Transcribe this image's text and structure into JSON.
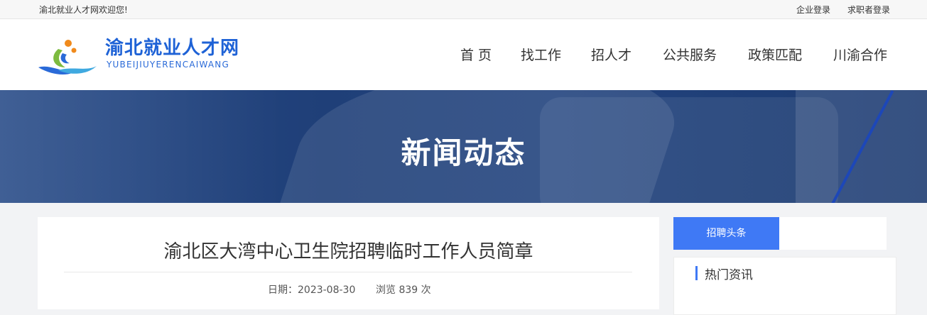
{
  "topbar": {
    "welcome": "渝北就业人才网欢迎您!",
    "company_login": "企业登录",
    "seeker_login": "求职者登录"
  },
  "brand": {
    "name": "渝北就业人才网",
    "pinyin": "YUBEIJIUYERENCAIWANG",
    "colors": {
      "primary": "#1e62d6",
      "accent": "#3f79f5",
      "orange": "#f08a1c",
      "green": "#7dbb3f"
    }
  },
  "nav": {
    "items": [
      {
        "label": "首 页"
      },
      {
        "label": "找工作"
      },
      {
        "label": "招人才"
      },
      {
        "label": "公共服务"
      },
      {
        "label": "政策匹配"
      },
      {
        "label": "川渝合作"
      }
    ]
  },
  "banner": {
    "title": "新闻动态"
  },
  "article": {
    "title": "渝北区大湾中心卫生院招聘临时工作人员简章",
    "date_label": "日期：2023-08-30",
    "views_label": "浏览 839 次"
  },
  "sidebar": {
    "tab_active": "招聘头条",
    "hot_news_header": "热门资讯"
  }
}
